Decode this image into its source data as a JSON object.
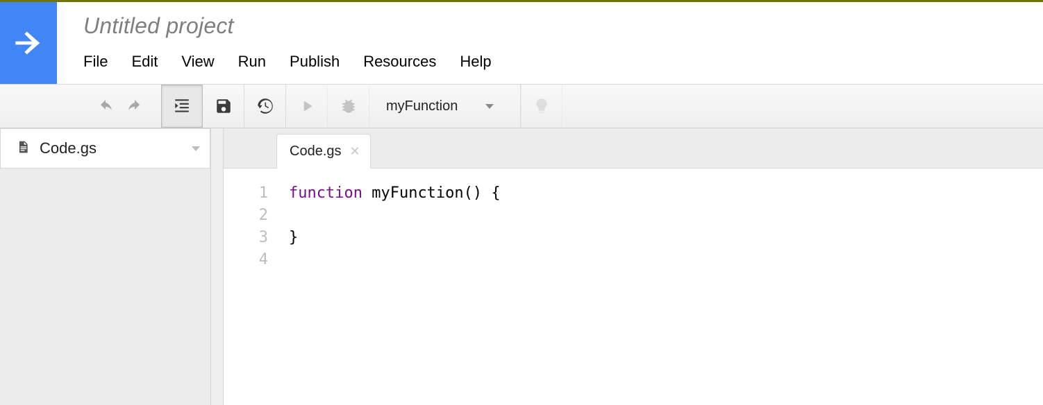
{
  "header": {
    "project_title": "Untitled project",
    "menus": [
      "File",
      "Edit",
      "View",
      "Run",
      "Publish",
      "Resources",
      "Help"
    ]
  },
  "toolbar": {
    "selected_function": "myFunction"
  },
  "sidebar": {
    "active_file": "Code.gs"
  },
  "editor": {
    "tab_label": "Code.gs",
    "line_numbers": [
      "1",
      "2",
      "3",
      "4"
    ],
    "code": {
      "keyword": "function",
      "rest_line1": " myFunction() {",
      "line2": "  ",
      "line3": "}",
      "line4": ""
    }
  }
}
